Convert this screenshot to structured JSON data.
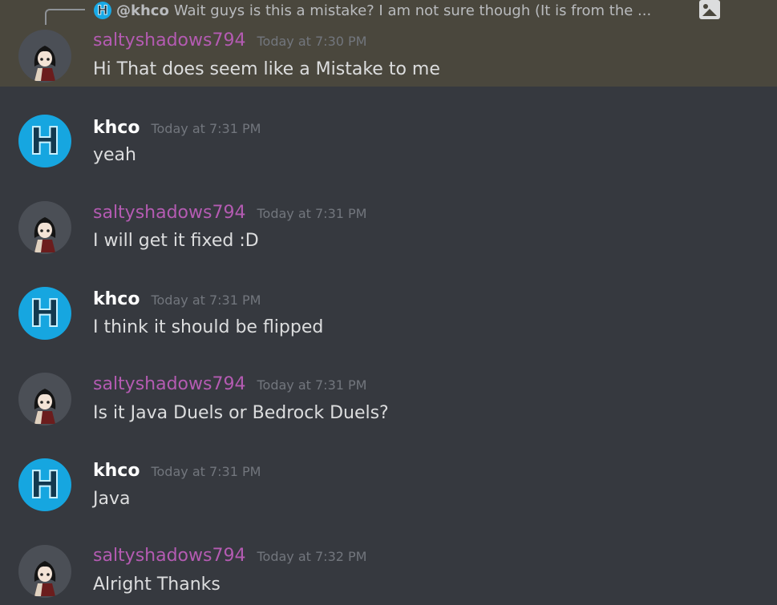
{
  "reply": {
    "author": "@khco",
    "preview": "Wait guys is this a mistake?  I am not sure though (It is from the ...",
    "attachment_icon": "image-icon"
  },
  "messages": [
    {
      "author": "saltyshadows794",
      "timestamp": "Today at 7:30 PM",
      "text": "Hi That does seem like a Mistake to me"
    },
    {
      "author": "khco",
      "timestamp": "Today at 7:31 PM",
      "text": "yeah"
    },
    {
      "author": "saltyshadows794",
      "timestamp": "Today at 7:31 PM",
      "text": "I will get it fixed :D"
    },
    {
      "author": "khco",
      "timestamp": "Today at 7:31 PM",
      "text": "I think it should be flipped"
    },
    {
      "author": "saltyshadows794",
      "timestamp": "Today at 7:31 PM",
      "text": "Is it Java Duels or Bedrock Duels?"
    },
    {
      "author": "khco",
      "timestamp": "Today at 7:31 PM",
      "text": "Java"
    },
    {
      "author": "saltyshadows794",
      "timestamp": "Today at 7:32 PM",
      "text": "Alright Thanks"
    }
  ],
  "colors": {
    "background": "#36393f",
    "highlight": "#4a473d",
    "salty_name": "#b45bb2",
    "khco_name": "#ffffff",
    "timestamp": "#72767d",
    "text": "#dcddde"
  }
}
